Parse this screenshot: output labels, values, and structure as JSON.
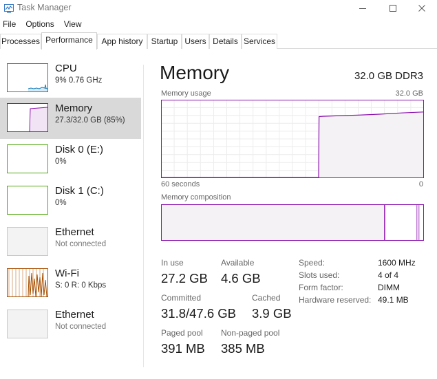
{
  "window": {
    "title": "Task Manager"
  },
  "menu": [
    "File",
    "Options",
    "View"
  ],
  "tabs": [
    "Processes",
    "Performance",
    "App history",
    "Startup",
    "Users",
    "Details",
    "Services"
  ],
  "active_tab": "Performance",
  "resources": [
    {
      "name": "CPU",
      "sub": "9%  0.76 GHz",
      "color": "#117dbb"
    },
    {
      "name": "Memory",
      "sub": "27.3/32.0 GB (85%)",
      "color": "#8b12ae"
    },
    {
      "name": "Disk 0 (E:)",
      "sub": "0%",
      "color": "#4da60c"
    },
    {
      "name": "Disk 1 (C:)",
      "sub": "0%",
      "color": "#4da60c"
    },
    {
      "name": "Ethernet",
      "sub": "Not connected",
      "color": "#bbbbbb"
    },
    {
      "name": "Wi-Fi",
      "sub": "S: 0  R: 0 Kbps",
      "color": "#a74f01"
    },
    {
      "name": "Ethernet",
      "sub": "Not connected",
      "color": "#bbbbbb"
    }
  ],
  "selected_resource": "Memory",
  "main": {
    "title": "Memory",
    "spec": "32.0 GB DDR3",
    "usage_label": "Memory usage",
    "usage_max": "32.0 GB",
    "time_left": "60 seconds",
    "time_right": "0",
    "composition_label": "Memory composition",
    "accent_color": "#8b12ae",
    "fill_color": "#f4f2f4"
  },
  "stats": {
    "in_use_label": "In use",
    "in_use": "27.2 GB",
    "available_label": "Available",
    "available": "4.6 GB",
    "committed_label": "Committed",
    "committed": "31.8/47.6 GB",
    "cached_label": "Cached",
    "cached": "3.9 GB",
    "paged_label": "Paged pool",
    "paged": "391 MB",
    "nonpaged_label": "Non-paged pool",
    "nonpaged": "385 MB"
  },
  "details": [
    {
      "label": "Speed:",
      "value": "1600 MHz"
    },
    {
      "label": "Slots used:",
      "value": "4 of 4"
    },
    {
      "label": "Form factor:",
      "value": "DIMM"
    },
    {
      "label": "Hardware reserved:",
      "value": "49.1 MB"
    }
  ],
  "chart_data": {
    "type": "area",
    "xlabel": "60 seconds",
    "ylabel": "Memory usage",
    "xlim": [
      60,
      0
    ],
    "ylim": [
      0,
      32.0
    ],
    "x": [
      60,
      57,
      54,
      51,
      48,
      45,
      42,
      39,
      36,
      33,
      30,
      27,
      24,
      23.9,
      23,
      20,
      15,
      10,
      5,
      0
    ],
    "series": [
      {
        "values": [
          0,
          0,
          0,
          0,
          0,
          0,
          0,
          0,
          0,
          0,
          0,
          0,
          0,
          25.3,
          25.4,
          25.6,
          25.9,
          26.3,
          26.8,
          27.2
        ]
      }
    ],
    "composition": {
      "segments": [
        {
          "value": 27.2
        },
        {
          "value": 0.05
        },
        {
          "value": 3.9
        },
        {
          "value": 0.25
        }
      ],
      "total": 32.0
    }
  }
}
